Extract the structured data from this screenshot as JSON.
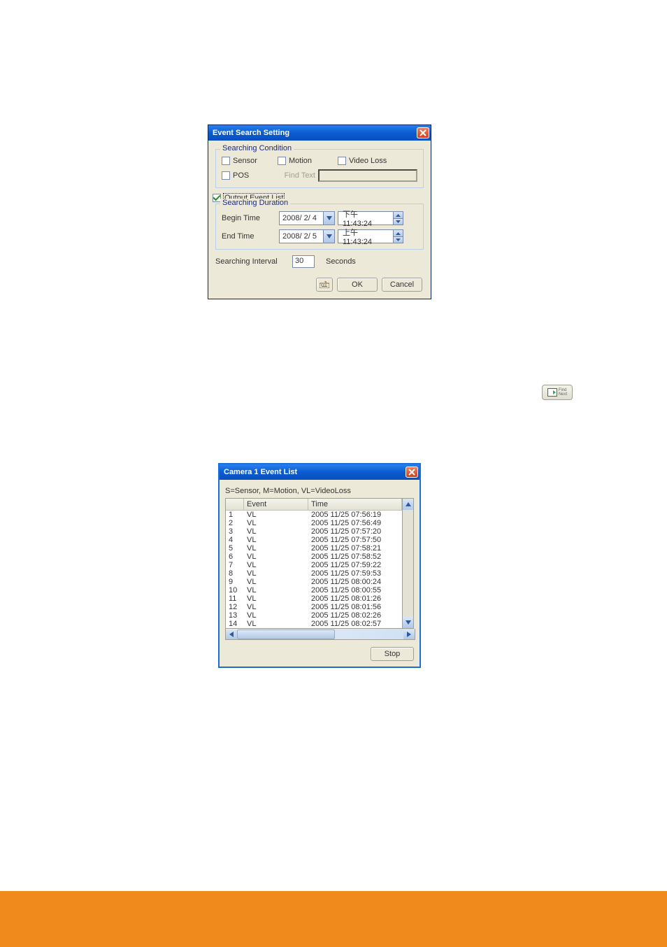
{
  "dlg1": {
    "title": "Event Search Setting",
    "searching_condition": {
      "legend": "Searching Condition",
      "sensor": "Sensor",
      "motion": "Motion",
      "video_loss": "Video Loss",
      "pos": "POS",
      "find_text": "Find Text"
    },
    "output_event_list": {
      "label": "Output Event List",
      "checked": true
    },
    "searching_duration": {
      "legend": "Searching Duration",
      "begin_time_label": "Begin Time",
      "begin_date": "2008/ 2/ 4",
      "begin_time": "下午 11:43:24",
      "end_time_label": "End Time",
      "end_date": "2008/ 2/ 5",
      "end_time": "上午 11:43:24"
    },
    "searching_interval": {
      "label": "Searching Interval",
      "value": "30",
      "unit": "Seconds"
    },
    "buttons": {
      "ok": "OK",
      "cancel": "Cancel"
    }
  },
  "findnext": {
    "l1": "Find",
    "l2": "Next"
  },
  "dlg2": {
    "title": "Camera 1   Event List",
    "caption": "S=Sensor, M=Motion, VL=VideoLoss",
    "columns": {
      "c0": "",
      "c1": "Event",
      "c2": "Time"
    },
    "rows": [
      {
        "n": "1",
        "event": "VL",
        "time": "2005 11/25 07:56:19"
      },
      {
        "n": "2",
        "event": "VL",
        "time": "2005 11/25 07:56:49"
      },
      {
        "n": "3",
        "event": "VL",
        "time": "2005 11/25 07:57:20"
      },
      {
        "n": "4",
        "event": "VL",
        "time": "2005 11/25 07:57:50"
      },
      {
        "n": "5",
        "event": "VL",
        "time": "2005 11/25 07:58:21"
      },
      {
        "n": "6",
        "event": "VL",
        "time": "2005 11/25 07:58:52"
      },
      {
        "n": "7",
        "event": "VL",
        "time": "2005 11/25 07:59:22"
      },
      {
        "n": "8",
        "event": "VL",
        "time": "2005 11/25 07:59:53"
      },
      {
        "n": "9",
        "event": "VL",
        "time": "2005 11/25 08:00:24"
      },
      {
        "n": "10",
        "event": "VL",
        "time": "2005 11/25 08:00:55"
      },
      {
        "n": "11",
        "event": "VL",
        "time": "2005 11/25 08:01:26"
      },
      {
        "n": "12",
        "event": "VL",
        "time": "2005 11/25 08:01:56"
      },
      {
        "n": "13",
        "event": "VL",
        "time": "2005 11/25 08:02:26"
      },
      {
        "n": "14",
        "event": "VL",
        "time": "2005 11/25 08:02:57"
      }
    ],
    "stop": "Stop"
  }
}
